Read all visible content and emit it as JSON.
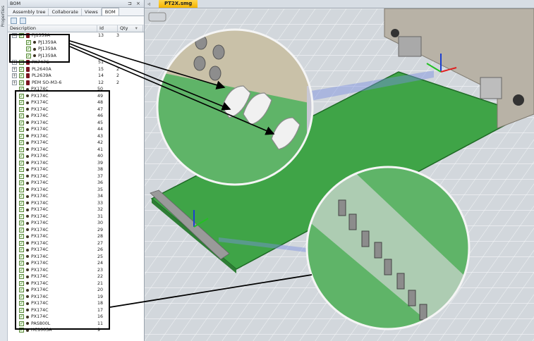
{
  "side_tab": {
    "label": "Properties"
  },
  "panel": {
    "title": "BOM",
    "pin_glyph": "⊐",
    "close_glyph": "×",
    "tabs": [
      "Assembly tree",
      "Collaborate",
      "Views",
      "BOM"
    ],
    "active_tab": "BOM",
    "columns": {
      "description": "Description",
      "id": "Id",
      "qty": "Qty"
    },
    "groups": [
      {
        "desc": "PJ1359A",
        "id": "13",
        "qty": "3",
        "expanded": true,
        "children": [
          "PJ1359A",
          "PJ1359A",
          "PJ1359A"
        ]
      },
      {
        "desc": "PX747G",
        "id": "51",
        "qty": ""
      },
      {
        "desc": "PL2640A",
        "id": "15",
        "qty": "2"
      },
      {
        "desc": "PL2639A",
        "id": "14",
        "qty": "2"
      },
      {
        "desc": "PEM SO-M3-6",
        "id": "12",
        "qty": "2"
      }
    ],
    "px_items": [
      {
        "desc": "PX174C",
        "id": "50"
      },
      {
        "desc": "PX174C",
        "id": "49"
      },
      {
        "desc": "PX174C",
        "id": "48"
      },
      {
        "desc": "PX174C",
        "id": "47"
      },
      {
        "desc": "PX174C",
        "id": "46"
      },
      {
        "desc": "PX174C",
        "id": "45"
      },
      {
        "desc": "PX174C",
        "id": "44"
      },
      {
        "desc": "PX174C",
        "id": "43"
      },
      {
        "desc": "PX174C",
        "id": "42"
      },
      {
        "desc": "PX174C",
        "id": "41"
      },
      {
        "desc": "PX174C",
        "id": "40"
      },
      {
        "desc": "PX174C",
        "id": "39"
      },
      {
        "desc": "PX174C",
        "id": "38"
      },
      {
        "desc": "PX174C",
        "id": "37"
      },
      {
        "desc": "PX174C",
        "id": "36"
      },
      {
        "desc": "PX174C",
        "id": "35"
      },
      {
        "desc": "PX174C",
        "id": "34"
      },
      {
        "desc": "PX174C",
        "id": "33"
      },
      {
        "desc": "PX174C",
        "id": "32"
      },
      {
        "desc": "PX174C",
        "id": "31"
      },
      {
        "desc": "PX174C",
        "id": "30"
      },
      {
        "desc": "PX174C",
        "id": "29"
      },
      {
        "desc": "PX174C",
        "id": "28"
      },
      {
        "desc": "PX174C",
        "id": "27"
      },
      {
        "desc": "PX174C",
        "id": "26"
      },
      {
        "desc": "PX174C",
        "id": "25"
      },
      {
        "desc": "PX174C",
        "id": "24"
      },
      {
        "desc": "PX174C",
        "id": "23"
      },
      {
        "desc": "PX174C",
        "id": "22"
      },
      {
        "desc": "PX174C",
        "id": "21"
      },
      {
        "desc": "PX174C",
        "id": "20"
      },
      {
        "desc": "PX174C",
        "id": "19"
      },
      {
        "desc": "PX174C",
        "id": "18"
      },
      {
        "desc": "PX174C",
        "id": "17"
      },
      {
        "desc": "PX174C",
        "id": "16"
      }
    ],
    "tail_items": [
      {
        "desc": "PAS800L",
        "id": "11"
      },
      {
        "desc": "HC1003A",
        "id": "9"
      }
    ]
  },
  "document": {
    "tab_label": "PT2X.smg",
    "nav_glyph": "◃"
  },
  "colors": {
    "board": "#3fa447",
    "board_dark": "#2e7d35",
    "grid_bg": "#d9dde2",
    "tab_accent": "#f5b400"
  }
}
